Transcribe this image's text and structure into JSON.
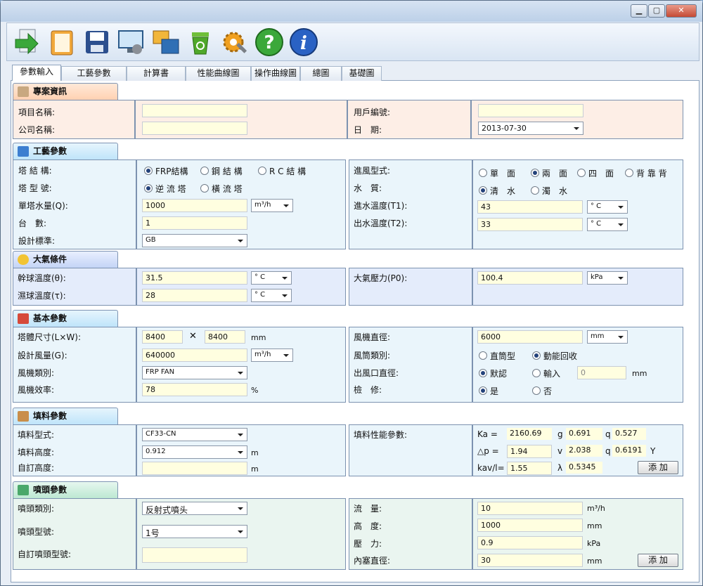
{
  "window": {
    "min_label": "▁",
    "max_label": "▢",
    "close_label": "✕"
  },
  "toolbar": {
    "icons": [
      "arrow-right-icon",
      "book-icon",
      "save-disk-icon",
      "monitor-settings-icon",
      "window-copy-icon",
      "recycle-bin-icon",
      "gear-wrench-icon",
      "help-icon",
      "info-icon"
    ]
  },
  "tabs": [
    "參數輸入",
    "工藝參數",
    "計算書",
    "性能曲線圖",
    "操作曲線圖",
    "總圖",
    "基礎圖"
  ],
  "project": {
    "title": "專案資訊",
    "item_name_label": "項目名稱:",
    "company_label": "公司名稱:",
    "user_id_label": "用戶編號:",
    "date_label": "日　期:",
    "date_value": "2013-07-30"
  },
  "process": {
    "title": "工藝參數",
    "structure_label": "塔 結 構:",
    "structure_opts": [
      "FRP結構",
      "鋼 結 構",
      "R C 結 構"
    ],
    "model_label": "塔 型 號:",
    "model_opts": [
      "逆 流 塔",
      "橫 流 塔"
    ],
    "flow_label": "單塔水量(Q):",
    "flow_value": "1000",
    "flow_unit": "m³/h",
    "count_label": "台　數:",
    "count_value": "1",
    "standard_label": "設計標準:",
    "standard_value": "GB",
    "inlet_label": "進風型式:",
    "inlet_opts": [
      "單　面",
      "兩　面",
      "四　面",
      "背 靠 背"
    ],
    "water_label": "水　質:",
    "water_opts": [
      "清　水",
      "濁　水"
    ],
    "t1_label": "進水溫度(T1):",
    "t1_value": "43",
    "t2_label": "出水溫度(T2):",
    "t2_value": "33",
    "temp_unit": "° C"
  },
  "atmosphere": {
    "title": "大氣條件",
    "dry_label": "幹球溫度(θ):",
    "dry_value": "31.5",
    "wet_label": "濕球溫度(τ):",
    "wet_value": "28",
    "temp_unit": "° C",
    "pressure_label": "大氣壓力(P0):",
    "pressure_value": "100.4",
    "pressure_unit": "kPa"
  },
  "basic": {
    "title": "基本參數",
    "size_label": "塔體尺寸(L×W):",
    "size_l": "8400",
    "size_x": "✕",
    "size_w": "8400",
    "size_unit": "mm",
    "air_label": "設計風量(G):",
    "air_value": "640000",
    "air_unit": "m³/h",
    "fan_type_label": "風機類別:",
    "fan_type_value": "FRP FAN",
    "eff_label": "風機效率:",
    "eff_value": "78",
    "eff_unit": "%",
    "fan_dia_label": "風機直徑:",
    "fan_dia_value": "6000",
    "fan_dia_unit": "mm",
    "duct_label": "風筒類別:",
    "duct_opts": [
      "直筒型",
      "動能回收"
    ],
    "outlet_label": "出風口直徑:",
    "outlet_opts": [
      "默認",
      "輸入"
    ],
    "outlet_value": "0",
    "outlet_unit": "mm",
    "repair_label": "檢　修:",
    "repair_opts": [
      "是",
      "否"
    ]
  },
  "fill": {
    "title": "填料參數",
    "type_label": "填料型式:",
    "type_value": "CF33-CN",
    "height_label": "填料高度:",
    "height_value": "0.912",
    "height_unit": "m",
    "custom_label": "自訂高度:",
    "custom_unit": "m",
    "perf_label": "填料性能參數:",
    "ka_label": "Ka =",
    "ka_value": "2160.69",
    "g_label": "g",
    "g_value": "0.691",
    "q_label": "q",
    "q_value": "0.527",
    "dp_label": "△p =",
    "dp_value": "1.94",
    "v_label": "v",
    "v_value": "2.038",
    "q2_label": "q",
    "q2_value": "0.6191",
    "y_label": "Y",
    "kav_label": "kav/l=",
    "kav_value": "1.55",
    "lambda_label": "λ",
    "lambda_value": "0.5345",
    "add_label": "添 加"
  },
  "nozzle": {
    "title": "噴頭參數",
    "type_label": "噴頭類別:",
    "type_value": "反射式噴头",
    "model_label": "噴頭型號:",
    "model_value": "1号",
    "custom_label": "自訂噴頭型號:",
    "flow_label": "流　量:",
    "flow_value": "10",
    "flow_unit": "m³/h",
    "height_label": "高　度:",
    "height_value": "1000",
    "height_unit": "mm",
    "pressure_label": "壓　力:",
    "pressure_value": "0.9",
    "pressure_unit": "kPa",
    "plug_label": "內塞直徑:",
    "plug_value": "30",
    "plug_unit": "mm",
    "add_label": "添 加"
  }
}
